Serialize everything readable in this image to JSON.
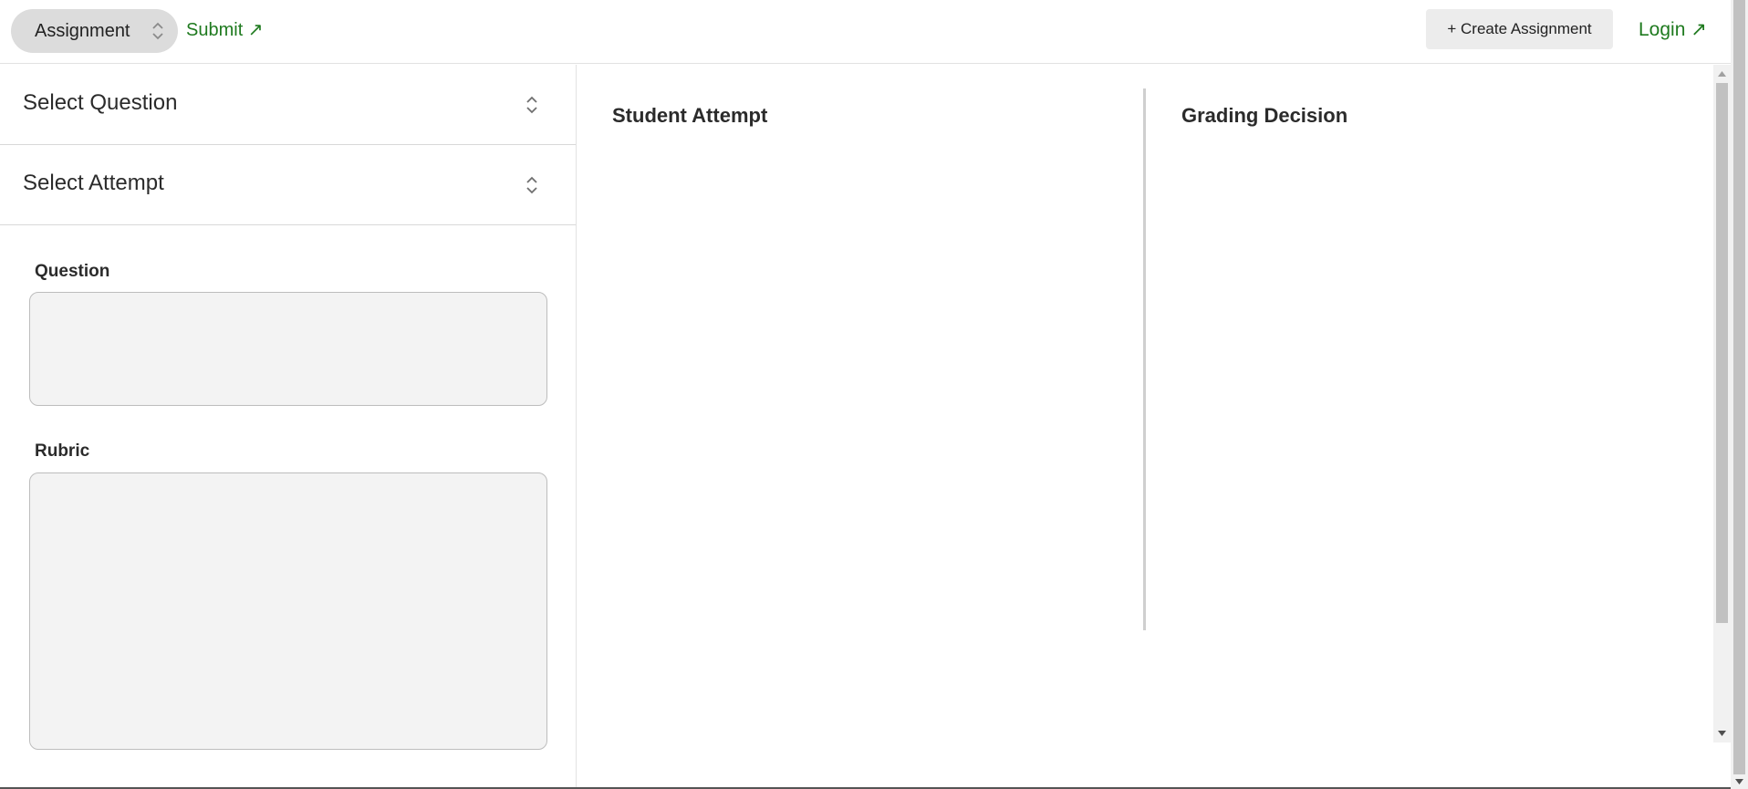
{
  "header": {
    "assignment_select": "Assignment",
    "submit_link": "Submit ↗",
    "create_button": "+ Create Assignment",
    "login_link": "Login ↗"
  },
  "sidebar": {
    "question_select": "Select Question",
    "attempt_select": "Select Attempt",
    "question_label": "Question",
    "rubric_label": "Rubric"
  },
  "main": {
    "student_attempt_title": "Student Attempt",
    "grading_decision_title": "Grading Decision"
  },
  "colors": {
    "link": "#1f7a1f",
    "select_bg": "#dcdcdc",
    "textbox_bg": "#f3f3f3"
  }
}
